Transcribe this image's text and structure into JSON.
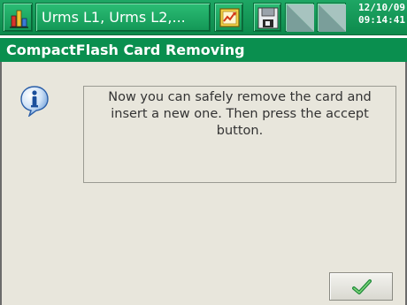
{
  "statusbar": {
    "app_icon": "bar-chart-icon",
    "title": "Urms L1, Urms L2,...",
    "trend_icon": "trend-chart-icon",
    "disk_icon": "floppy-disk-icon",
    "signal_icons": [
      "signal-indicator-icon",
      "signal-indicator-icon"
    ],
    "date": "12/10/09",
    "time": "09:14:41"
  },
  "dialog": {
    "title": "CompactFlash Card Removing",
    "icon": "info-icon",
    "message": "Now you can safely remove the card and insert a new one. Then press the accept button.",
    "accept_icon": "checkmark-icon"
  },
  "colors": {
    "statusbar": "#1ea664",
    "header": "#0a8f4f",
    "dialog_bg": "#e8e6dc"
  }
}
